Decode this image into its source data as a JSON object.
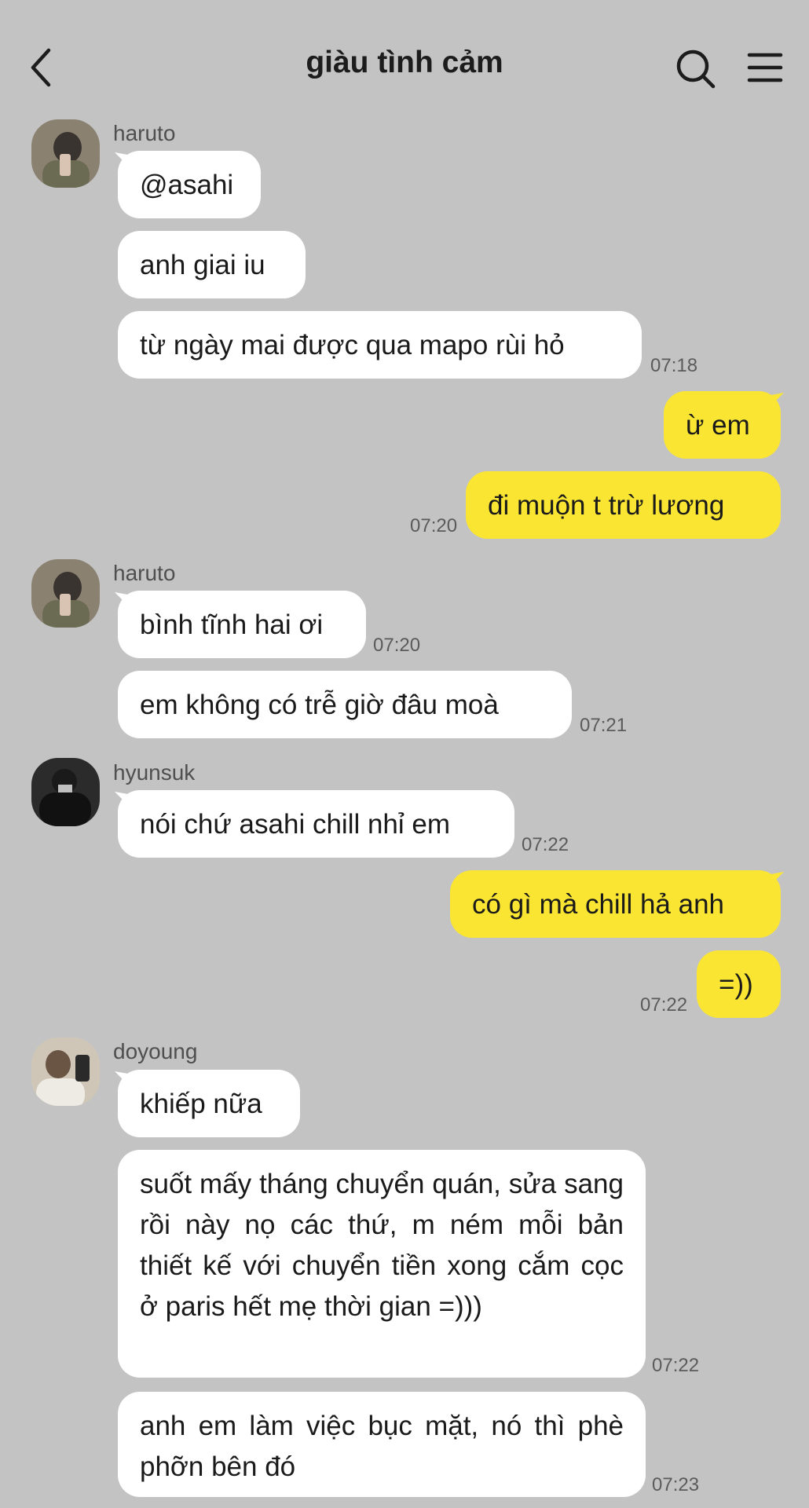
{
  "header": {
    "title": "giàu tình cảm"
  },
  "colors": {
    "background": "#c3c3c3",
    "incoming_bubble": "#ffffff",
    "outgoing_bubble": "#fae632"
  },
  "icons": {
    "back": "chevron-left-icon",
    "search": "search-icon",
    "menu": "hamburger-menu-icon"
  },
  "senders": {
    "haruto": "haruto",
    "hyunsuk": "hyunsuk",
    "doyoung": "doyoung"
  },
  "messages": [
    {
      "from": "haruto",
      "text": "@asahi",
      "time": ""
    },
    {
      "from": "haruto",
      "text": "anh giai iu",
      "time": ""
    },
    {
      "from": "haruto",
      "text": "từ ngày mai được qua mapo rùi hỏ",
      "time": "07:18"
    },
    {
      "from": "me",
      "text": "ừ em",
      "time": ""
    },
    {
      "from": "me",
      "text": "đi muộn t trừ lương",
      "time": "07:20"
    },
    {
      "from": "haruto",
      "text": "bình tĩnh hai ơi",
      "time": "07:20"
    },
    {
      "from": "haruto",
      "text": "em không có trễ giờ đâu moà",
      "time": "07:21"
    },
    {
      "from": "hyunsuk",
      "text": "nói chứ asahi chill nhỉ em",
      "time": "07:22"
    },
    {
      "from": "me",
      "text": "có gì mà chill hả anh",
      "time": ""
    },
    {
      "from": "me",
      "text": "=))",
      "time": "07:22"
    },
    {
      "from": "doyoung",
      "text": "khiếp nữa",
      "time": ""
    },
    {
      "from": "doyoung",
      "text": "suốt mấy tháng chuyển quán, sửa sang rồi này nọ các thứ, m ném mỗi bản thiết kế với chuyển tiền xong cắm cọc ở paris hết mẹ thời gian =)))",
      "time": "07:22"
    },
    {
      "from": "doyoung",
      "text": "anh em làm việc bục mặt, nó thì phè phỡn bên đó",
      "time": "07:23"
    }
  ]
}
